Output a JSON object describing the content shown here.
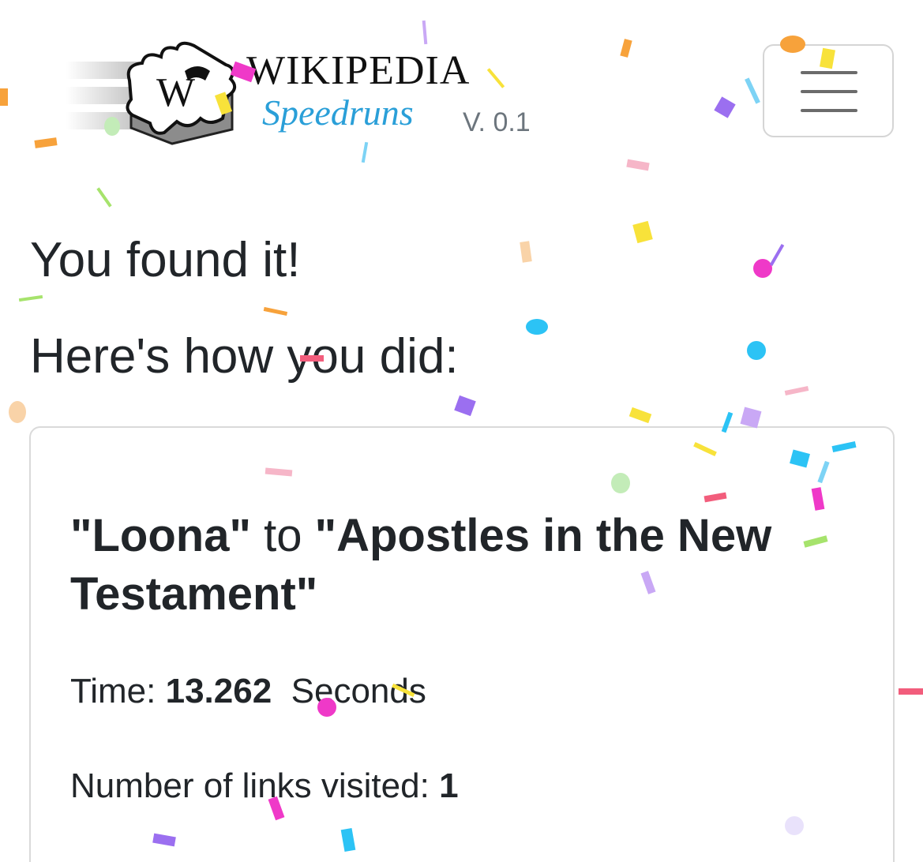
{
  "header": {
    "logo_letter": "W",
    "title": "WIKIPEDIA",
    "subtitle": "Speedruns",
    "version": "V. 0.1"
  },
  "colors": {
    "subtitle_blue": "#2a9fd8",
    "text": "#212529",
    "muted": "#6c757d",
    "border": "#dadada"
  },
  "icons": {
    "logo": "wikipedia-puzzle-logo",
    "menu": "hamburger-menu-icon"
  },
  "main": {
    "found_text": "You found it!",
    "summary_text": "Here's how you did:"
  },
  "result": {
    "start": "\"Loona\"",
    "to": "to",
    "end": "\"Apostles in the New Testament\"",
    "time_label": "Time:",
    "time_value": "13.262",
    "time_unit": "Seconds",
    "links_label": "Number of links visited:",
    "links_value": "1"
  }
}
